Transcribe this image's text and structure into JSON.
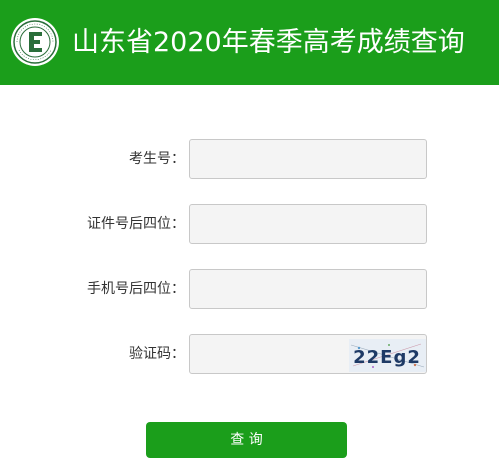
{
  "header": {
    "title": "山东省2020年春季高考成绩查询",
    "logo_icon": "exam-school-logo-icon",
    "background_color": "#1b9e1b"
  },
  "form": {
    "fields": [
      {
        "label": "考生号：",
        "value": "",
        "placeholder": ""
      },
      {
        "label": "证件号后四位：",
        "value": "",
        "placeholder": ""
      },
      {
        "label": "手机号后四位：",
        "value": "",
        "placeholder": ""
      },
      {
        "label": "验证码：",
        "value": "",
        "placeholder": ""
      }
    ],
    "captcha_text": "22Eg2",
    "submit_label": "查 询"
  },
  "colors": {
    "brand_green": "#1b9e1b",
    "input_bg": "#f4f4f4"
  }
}
